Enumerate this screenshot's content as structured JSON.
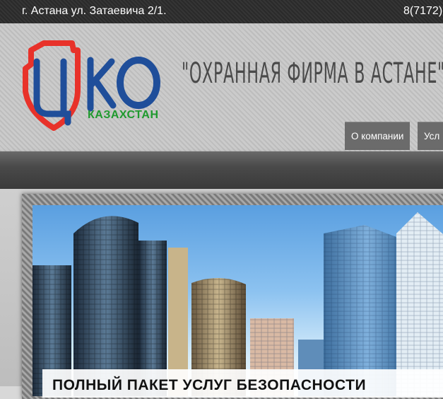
{
  "topbar": {
    "address": "г. Астана ул. Затаевича 2/1.",
    "phone": "8(7172)"
  },
  "logo": {
    "letters": "ЦКО",
    "subtitle": "КАЗАХСТАН",
    "colors": {
      "shield": "#e8322a",
      "letters": "#1f4e9a",
      "subtitle": "#1f9a2e"
    }
  },
  "header": {
    "slogan": "\"ОХРАННАЯ ФИРМА В АСТАНЕ\""
  },
  "nav": {
    "items": [
      {
        "label": "О компании"
      },
      {
        "label": "Усл"
      }
    ]
  },
  "slider": {
    "caption": "ПОЛНЫЙ ПАКЕТ УСЛУГ БЕЗОПАСНОСТИ"
  }
}
